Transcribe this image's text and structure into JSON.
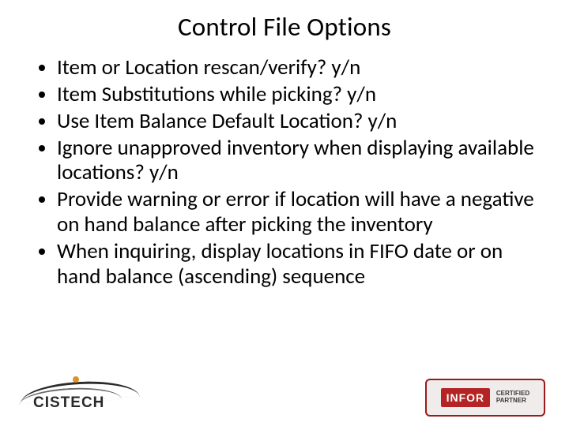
{
  "title": "Control File Options",
  "bullets": [
    "Item or Location rescan/verify? y/n",
    "Item Substitutions while picking? y/n",
    "Use Item Balance Default Location? y/n",
    "Ignore unapproved inventory when displaying available locations? y/n",
    "Provide warning or error if location will have a negative on hand balance after picking the inventory",
    "When inquiring, display locations in FIFO date or on hand balance (ascending) sequence"
  ],
  "logos": {
    "cistech_text": "CISTECH",
    "infor_mark": "INFOR",
    "infor_sub1": "CERTIFIED",
    "infor_sub2": "PARTNER"
  }
}
